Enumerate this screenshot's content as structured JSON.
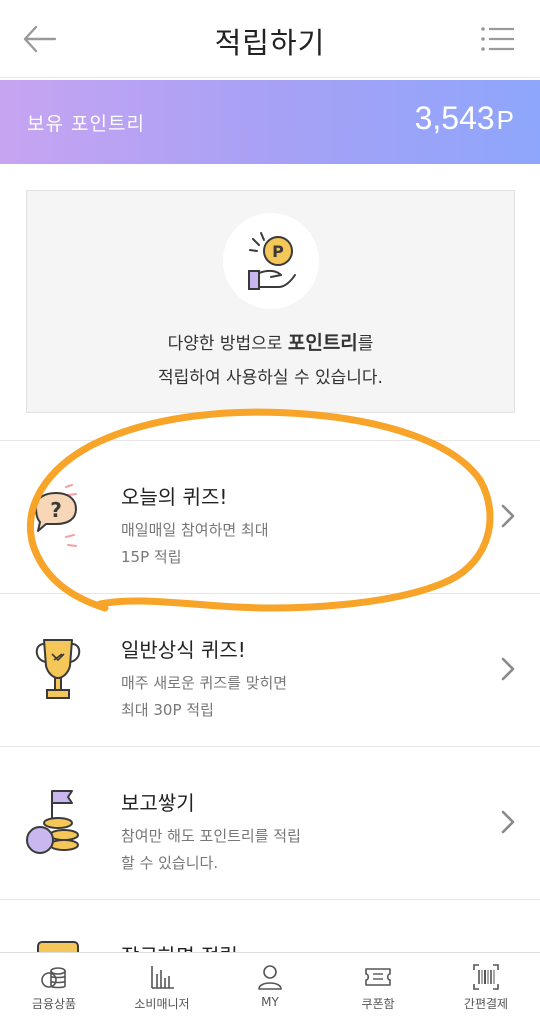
{
  "header": {
    "title": "적립하기"
  },
  "points": {
    "label": "보유 포인트리",
    "value": "3,543",
    "unit": "P"
  },
  "info": {
    "line1_prefix": "다양한 방법으로 ",
    "line1_bold": "포인트리",
    "line1_suffix": "를",
    "line2": "적립하여 사용하실 수 있습니다."
  },
  "items": [
    {
      "title": "오늘의 퀴즈!",
      "desc1": "매일매일 참여하면 최대",
      "desc2": "15P 적립"
    },
    {
      "title": "일반상식 퀴즈!",
      "desc1": "매주 새로운 퀴즈를 맞히면",
      "desc2": "최대 30P 적립"
    },
    {
      "title": "보고쌓기",
      "desc1": "참여만 해도 포인트리를 적립",
      "desc2": "할 수 있습니다."
    },
    {
      "title": "잠금하면 적립"
    }
  ],
  "nav": [
    {
      "label": "금융상품",
      "icon": "coins-icon"
    },
    {
      "label": "소비매니저",
      "icon": "bar-chart-icon"
    },
    {
      "label": "MY",
      "icon": "person-icon"
    },
    {
      "label": "쿠폰함",
      "icon": "ticket-icon"
    },
    {
      "label": "간편결제",
      "icon": "barcode-icon"
    }
  ],
  "colors": {
    "gradient_start": "#c7a4f2",
    "gradient_end": "#8ea6fb",
    "annotation": "#f7a428"
  }
}
